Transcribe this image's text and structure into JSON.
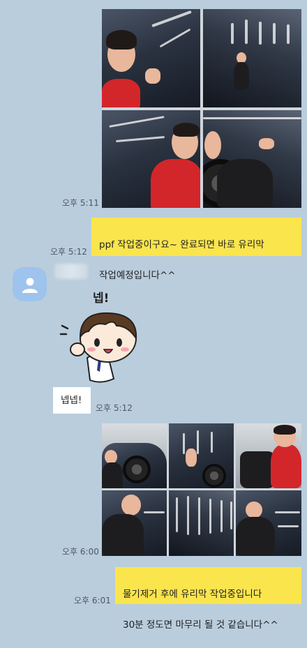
{
  "chat": {
    "messages": [
      {
        "type": "photo-grid",
        "sender": "me",
        "time": "오후 5:11",
        "photo_count": 4
      },
      {
        "type": "text",
        "sender": "me",
        "time": "오후 5:12",
        "lines": [
          "ppf 작업중이구요~ 완료되면 바로 유리막",
          "작업예정입니다^^"
        ]
      },
      {
        "type": "sticker",
        "sender": "other",
        "caption": "넵!"
      },
      {
        "type": "text",
        "sender": "other",
        "time": "오후 5:12",
        "text": "넵넵!"
      },
      {
        "type": "photo-grid",
        "sender": "me",
        "time": "오후 6:00",
        "photo_count": 6
      },
      {
        "type": "text",
        "sender": "me",
        "time": "오후 6:01",
        "lines": [
          "물기제거 후에 유리막 작업중입니다",
          "30분 정도면 마무리 될 것 같습니다^^"
        ]
      }
    ]
  },
  "colors": {
    "background": "#b9cddd",
    "my_bubble": "#fbe54d",
    "other_bubble": "#ffffff",
    "avatar": "#9ec3ec"
  },
  "icons": {
    "avatar": "person-silhouette-icon"
  }
}
